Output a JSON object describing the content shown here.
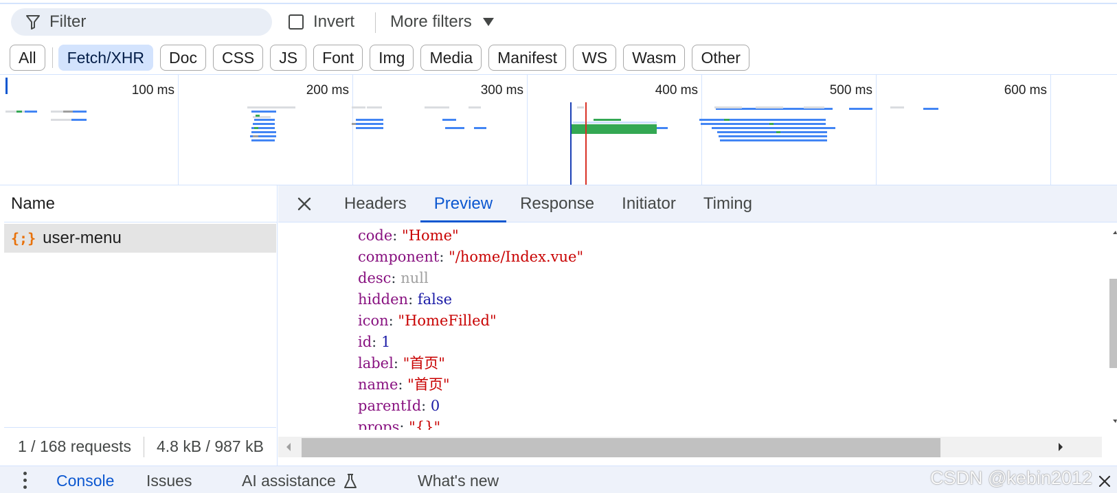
{
  "toolbar": {
    "filter_placeholder": "Filter",
    "invert_label": "Invert",
    "more_filters_label": "More filters"
  },
  "type_filters": {
    "all": "All",
    "fetch_xhr": "Fetch/XHR",
    "doc": "Doc",
    "css": "CSS",
    "js": "JS",
    "font": "Font",
    "img": "Img",
    "media": "Media",
    "manifest": "Manifest",
    "ws": "WS",
    "wasm": "Wasm",
    "other": "Other"
  },
  "overview": {
    "ticks": [
      "100 ms",
      "200 ms",
      "300 ms",
      "400 ms",
      "500 ms",
      "600 ms"
    ]
  },
  "requests": {
    "column_name": "Name",
    "selected_name": "user-menu",
    "count_text": "1 / 168 requests",
    "size_text": "4.8 kB / 987 kB"
  },
  "detail_tabs": {
    "headers": "Headers",
    "preview": "Preview",
    "response": "Response",
    "initiator": "Initiator",
    "timing": "Timing"
  },
  "preview_lines": [
    {
      "key": "code",
      "value": "\"Home\"",
      "kind": "str"
    },
    {
      "key": "component",
      "value": "\"/home/Index.vue\"",
      "kind": "str"
    },
    {
      "key": "desc",
      "value": "null",
      "kind": "nul"
    },
    {
      "key": "hidden",
      "value": "false",
      "kind": "kw"
    },
    {
      "key": "icon",
      "value": "\"HomeFilled\"",
      "kind": "str"
    },
    {
      "key": "id",
      "value": "1",
      "kind": "kw"
    },
    {
      "key": "label",
      "value": "\"首页\"",
      "kind": "str"
    },
    {
      "key": "name",
      "value": "\"首页\"",
      "kind": "str"
    },
    {
      "key": "parentId",
      "value": "0",
      "kind": "kw"
    },
    {
      "key": "props",
      "value": "\"{}\"",
      "kind": "str"
    }
  ],
  "drawer": {
    "console": "Console",
    "issues": "Issues",
    "ai_assistance": "AI assistance",
    "whats_new": "What's new"
  },
  "watermark": "CSDN @kebin2012",
  "colors": {
    "accent": "#0b57d0",
    "chip_active_bg": "#d3e3fd",
    "string_value": "#c80000",
    "key": "#881280",
    "bar_blue": "#4285f4",
    "bar_green": "#34a853",
    "marker_blue": "#1a3fb5",
    "marker_red": "#d93025"
  }
}
